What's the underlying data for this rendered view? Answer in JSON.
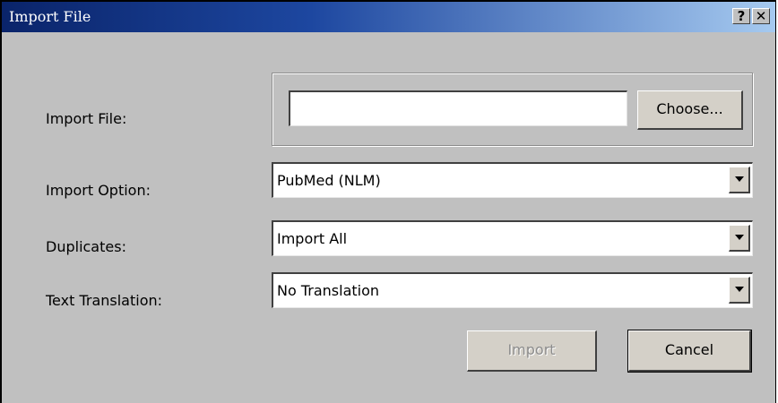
{
  "window": {
    "title": "Import File",
    "help_glyph": "?",
    "close_glyph": "✕"
  },
  "labels": {
    "import_file": "Import File:",
    "import_option": "Import Option:",
    "duplicates": "Duplicates:",
    "text_translation": "Text Translation:"
  },
  "file_field": {
    "value": "",
    "choose_label": "Choose..."
  },
  "selects": {
    "import_option": "PubMed (NLM)",
    "duplicates": "Import All",
    "text_translation": "No Translation"
  },
  "buttons": {
    "import_label": "Import",
    "cancel_label": "Cancel"
  },
  "icons": {
    "dropdown": "chevron-down-icon",
    "help": "help-icon",
    "close": "close-icon"
  },
  "colors": {
    "titlebar_start": "#0a246a",
    "titlebar_end": "#a6caf0",
    "dialog_bg": "#c0c0c0"
  }
}
